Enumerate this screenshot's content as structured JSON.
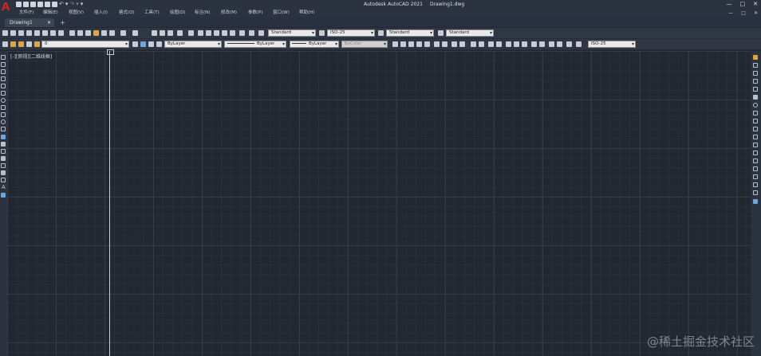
{
  "app": {
    "title_app": "Autodesk AutoCAD 2021",
    "title_file": "Drawing1.dwg",
    "logo_letter": "A"
  },
  "window_controls": [
    "—",
    "□",
    "✕"
  ],
  "menubar": {
    "items": [
      "文件(F)",
      "编辑(E)",
      "视图(V)",
      "插入(I)",
      "格式(O)",
      "工具(T)",
      "绘图(D)",
      "标注(N)",
      "修改(M)",
      "参数(P)",
      "窗口(W)",
      "帮助(H)"
    ],
    "right_controls": [
      "—",
      "□",
      "✕"
    ]
  },
  "tabs": {
    "items": [
      {
        "label": "Drawing1",
        "close": "✕"
      }
    ],
    "add": "+"
  },
  "toolbar1": {
    "text_style": "Standard",
    "dim_style": "ISO-25",
    "table_style": "Standard",
    "multileader_style": "Standard"
  },
  "toolbar2": {
    "layer": "0",
    "color": "ByLayer",
    "linetype": "ByLayer",
    "lineweight": "ByLayer",
    "plot_style": "ByColor",
    "dim_style2": "ISO-25"
  },
  "viewport": {
    "label": "[-][俯视][二维线框]"
  },
  "watermark": "@稀土掘金技术社区",
  "colors": {
    "canvas_bg": "#212830",
    "ribbon_bg": "#2f3744",
    "logo_red": "#e2231a"
  }
}
